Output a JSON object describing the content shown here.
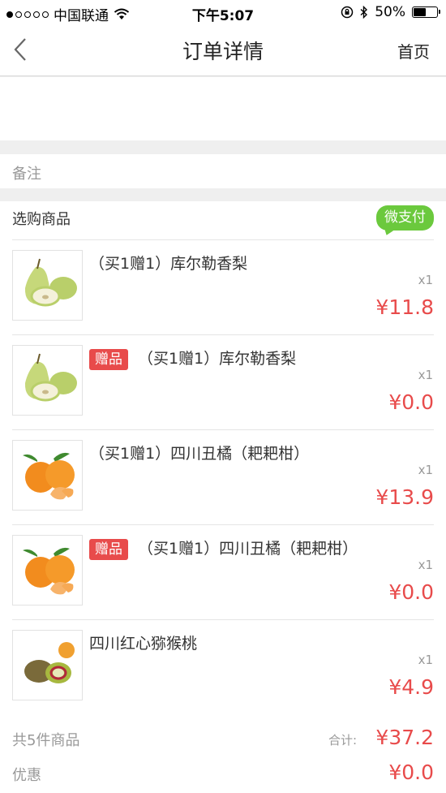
{
  "status_bar": {
    "carrier": "中国联通",
    "time": "下午5:07",
    "battery": "50%",
    "battery_level": 0.5
  },
  "nav": {
    "title": "订单详情",
    "home_label": "首页",
    "back_icon": "chevron-left-icon"
  },
  "remark": {
    "label": "备注"
  },
  "goods": {
    "header": "选购商品",
    "payment_badge": "微支付",
    "gift_tag": "赠品",
    "items": [
      {
        "name": "（买1赠1）库尔勒香梨",
        "qty": "x1",
        "price": "¥11.8",
        "gift": false,
        "image": "pear"
      },
      {
        "name": "（买1赠1）库尔勒香梨",
        "qty": "x1",
        "price": "¥0.0",
        "gift": true,
        "image": "pear"
      },
      {
        "name": "（买1赠1）四川丑橘（耙耙柑）",
        "qty": "x1",
        "price": "¥13.9",
        "gift": false,
        "image": "orange"
      },
      {
        "name": "（买1赠1）四川丑橘（耙耙柑）",
        "qty": "x1",
        "price": "¥0.0",
        "gift": true,
        "image": "orange"
      },
      {
        "name": "四川红心猕猴桃",
        "qty": "x1",
        "price": "¥4.9",
        "gift": false,
        "image": "kiwi"
      }
    ]
  },
  "summary": {
    "count_text": "共5件商品",
    "total_label": "合计:",
    "total_value": "¥37.2"
  },
  "discount": {
    "label": "优惠",
    "value": "¥0.0"
  },
  "colors": {
    "accent_red": "#e84b4b",
    "wechat_green": "#6bc93d"
  }
}
